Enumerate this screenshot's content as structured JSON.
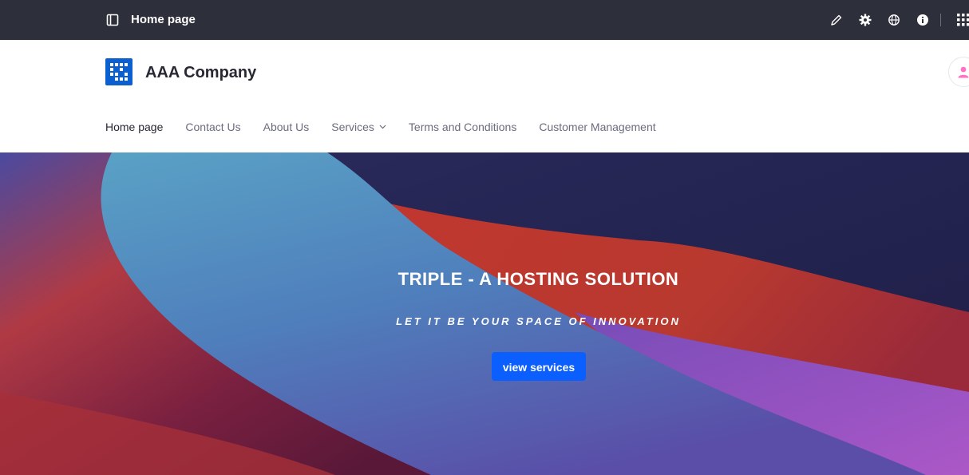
{
  "admin_bar": {
    "page_title": "Home page",
    "icons": [
      "panel-toggle-icon",
      "pencil-icon",
      "gear-icon",
      "globe-icon",
      "info-icon",
      "apps-grid-icon"
    ]
  },
  "header": {
    "company_name": "AAA Company",
    "brand_color": "#0b5fcf"
  },
  "nav": {
    "items": [
      {
        "label": "Home page",
        "active": true
      },
      {
        "label": "Contact Us"
      },
      {
        "label": "About Us"
      },
      {
        "label": "Services",
        "has_dropdown": true
      },
      {
        "label": "Terms and Conditions"
      },
      {
        "label": "Customer Management"
      }
    ]
  },
  "hero": {
    "title": "TRIPLE - A HOSTING SOLUTION",
    "subtitle": "LET IT BE YOUR SPACE OF INNOVATION",
    "button_label": "view services",
    "button_color": "#0b5fff"
  }
}
